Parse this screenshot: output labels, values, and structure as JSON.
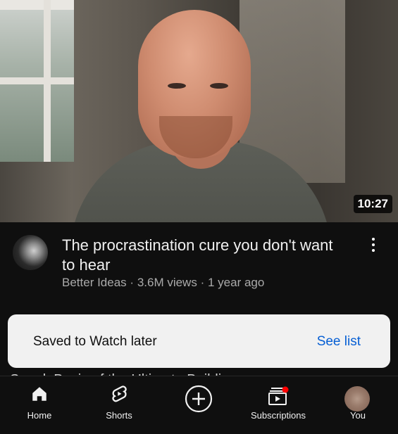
{
  "video": {
    "duration": "10:27",
    "title": "The procrastination cure you don't want to hear",
    "channel": "Better Ideas",
    "views": "3.6M views",
    "age": "1 year ago",
    "separator": "·"
  },
  "toast": {
    "message": "Saved to Watch later",
    "action_label": "See list"
  },
  "peek_text": "Speak Basis of the Ultimate Building",
  "nav": {
    "items": [
      {
        "label": "Home",
        "icon": "home-icon"
      },
      {
        "label": "Shorts",
        "icon": "shorts-icon"
      },
      {
        "label": "",
        "icon": "create-icon"
      },
      {
        "label": "Subscriptions",
        "icon": "subscriptions-icon"
      },
      {
        "label": "You",
        "icon": "avatar"
      }
    ]
  },
  "colors": {
    "background": "#0f0f0f",
    "toast_bg": "#f1f1f1",
    "link": "#065fd4",
    "notification_dot": "#ff0000"
  }
}
